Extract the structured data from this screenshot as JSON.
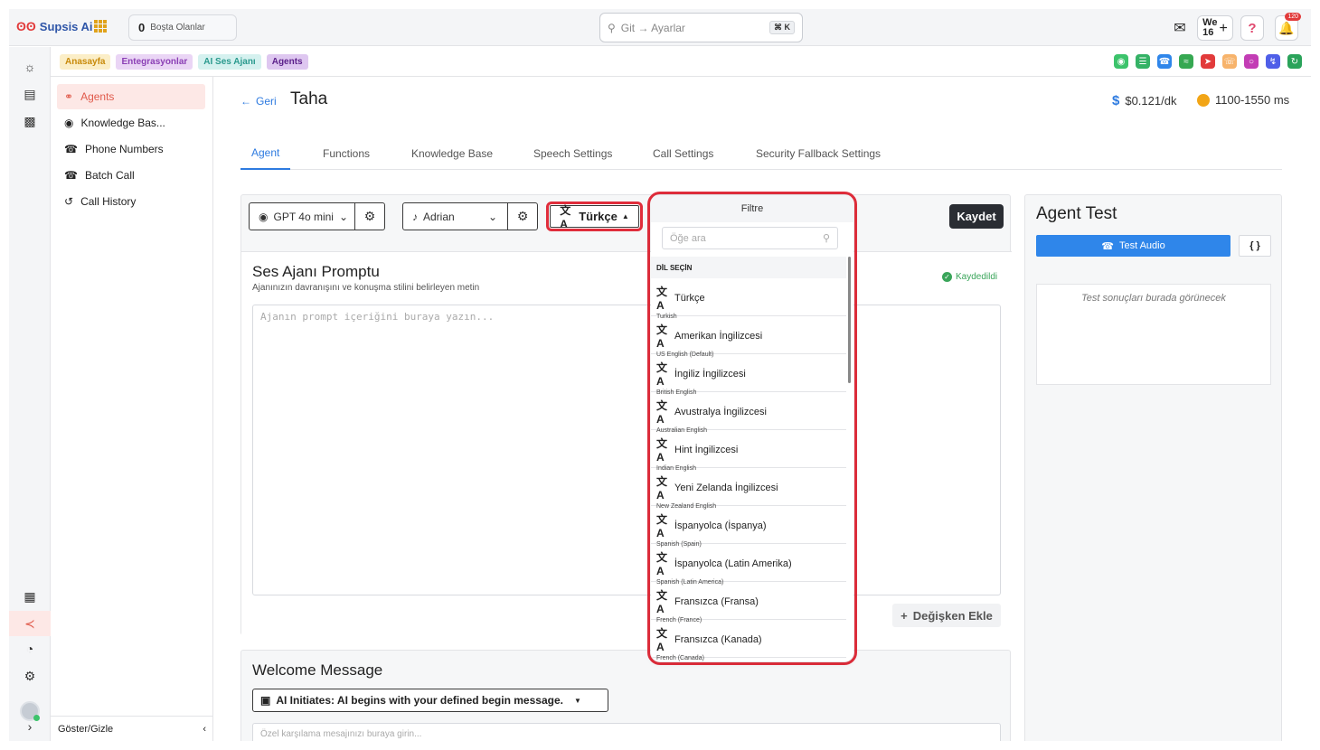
{
  "brand": {
    "name": "Supsis Ai"
  },
  "topbar": {
    "idle_count": "0",
    "idle_label": "Boşta Olanlar",
    "search_placeholder": "Git → Ayarlar",
    "search_shortcut": "⌘ K",
    "week_label": "We",
    "week_number": "16",
    "notification_count": "120"
  },
  "breadcrumbs": [
    "Anasayfa",
    "Entegrasyonlar",
    "AI Ses Ajanı",
    "Agents"
  ],
  "menu": {
    "items": [
      "Agents",
      "Knowledge Bas...",
      "Phone Numbers",
      "Batch Call",
      "Call History"
    ],
    "footer_label": "Göster/Gizle"
  },
  "header": {
    "back_label": "Geri",
    "agent_name": "Taha",
    "price": "$0.121/dk",
    "latency": "1100-1550 ms"
  },
  "tabs": [
    "Agent",
    "Functions",
    "Knowledge Base",
    "Speech Settings",
    "Call Settings",
    "Security Fallback Settings"
  ],
  "controls": {
    "model": "GPT 4o mini",
    "voice": "Adrian",
    "language": "Türkçe",
    "save_label": "Kaydet"
  },
  "prompt": {
    "title": "Ses Ajanı Promptu",
    "subtitle": "Ajanınızın davranışını ve konuşma stilini belirleyen metin",
    "saved_label": "Kaydedildi",
    "placeholder": "Ajanın prompt içeriğini buraya yazın...",
    "add_variable_label": "Değişken Ekle"
  },
  "welcome": {
    "title": "Welcome Message",
    "mode": "AI Initiates: AI begins with your defined begin message.",
    "placeholder": "Özel karşılama mesajınızı buraya girin..."
  },
  "agent_test": {
    "title": "Agent Test",
    "test_button": "Test Audio",
    "code_button": "{ }",
    "result_placeholder": "Test sonuçları burada görünecek"
  },
  "language_dropdown": {
    "header": "Filtre",
    "search_placeholder": "Öğe ara",
    "section_label": "DİL SEÇİN",
    "options": [
      {
        "name": "Türkçe",
        "sub": "Turkish"
      },
      {
        "name": "Amerikan İngilizcesi",
        "sub": "US English (Default)"
      },
      {
        "name": "İngiliz İngilizcesi",
        "sub": "British English"
      },
      {
        "name": "Avustralya İngilizcesi",
        "sub": "Australian English"
      },
      {
        "name": "Hint İngilizcesi",
        "sub": "Indian English"
      },
      {
        "name": "Yeni Zelanda İngilizcesi",
        "sub": "New Zealand English"
      },
      {
        "name": "İspanyolca (İspanya)",
        "sub": "Spanish (Spain)"
      },
      {
        "name": "İspanyolca (Latin Amerika)",
        "sub": "Spanish (Latin America)"
      },
      {
        "name": "Fransızca (Fransa)",
        "sub": "French (France)"
      },
      {
        "name": "Fransızca (Kanada)",
        "sub": "French (Canada)"
      }
    ]
  },
  "colors": {
    "accent": "#2e7be0",
    "brand_red": "#e05a4b",
    "highlight": "#e02d3b"
  }
}
